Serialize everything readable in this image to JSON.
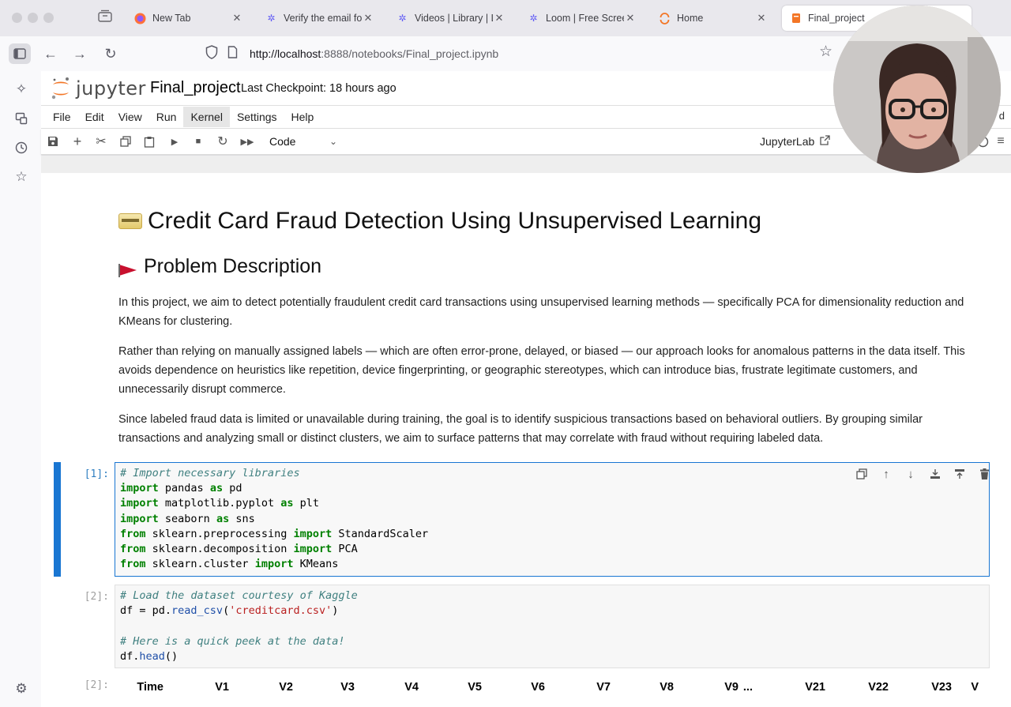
{
  "browser": {
    "tabs": [
      {
        "title": "New Tab",
        "icon": "firefox-icon"
      },
      {
        "title": "Verify the email for",
        "icon": "gear-icon"
      },
      {
        "title": "Videos | Library | L",
        "icon": "gear-icon"
      },
      {
        "title": "Loom | Free Screen",
        "icon": "gear-icon"
      },
      {
        "title": "Home",
        "icon": "loading-icon"
      },
      {
        "title": "Final_project",
        "icon": "notebook-icon"
      }
    ],
    "close_glyph": "✕",
    "url_host": "http://localhost",
    "url_rest": ":8888/notebooks/Final_project.ipynb"
  },
  "jupyter": {
    "logo_text": "jupyter",
    "notebook_title": "Final_project",
    "checkpoint": "Last Checkpoint: 18 hours ago",
    "menu": [
      "File",
      "Edit",
      "View",
      "Run",
      "Kernel",
      "Settings",
      "Help"
    ],
    "active_menu": "Kernel",
    "trusted_partial": "d",
    "cell_type": "Code",
    "open_in": "JupyterLab"
  },
  "notebook": {
    "h1": "Credit Card Fraud Detection Using Unsupervised Learning",
    "h2": "Problem Description",
    "paragraphs": [
      "In this project, we aim to detect potentially fraudulent credit card transactions using unsupervised learning methods — specifically PCA for dimensionality reduction and KMeans for clustering.",
      "Rather than relying on manually assigned labels — which are often error-prone, delayed, or biased — our approach looks for anomalous patterns in the data itself. This avoids dependence on heuristics like repetition, device fingerprinting, or geographic stereotypes, which can introduce bias, frustrate legitimate customers, and unnecessarily disrupt commerce.",
      "Since labeled fraud data is limited or unavailable during training, the goal is to identify suspicious transactions based on behavioral outliers. By grouping similar transactions and analyzing small or distinct clusters, we aim to surface patterns that may correlate with fraud without requiring labeled data."
    ],
    "cell1_prompt": "[1]:",
    "cell2_prompt": "[2]:",
    "out2_prompt": "[2]:",
    "df_columns": [
      "Time",
      "V1",
      "V2",
      "V3",
      "V4",
      "V5",
      "V6",
      "V7",
      "V8",
      "V9",
      "...",
      "V21",
      "V22",
      "V23",
      "V"
    ]
  }
}
